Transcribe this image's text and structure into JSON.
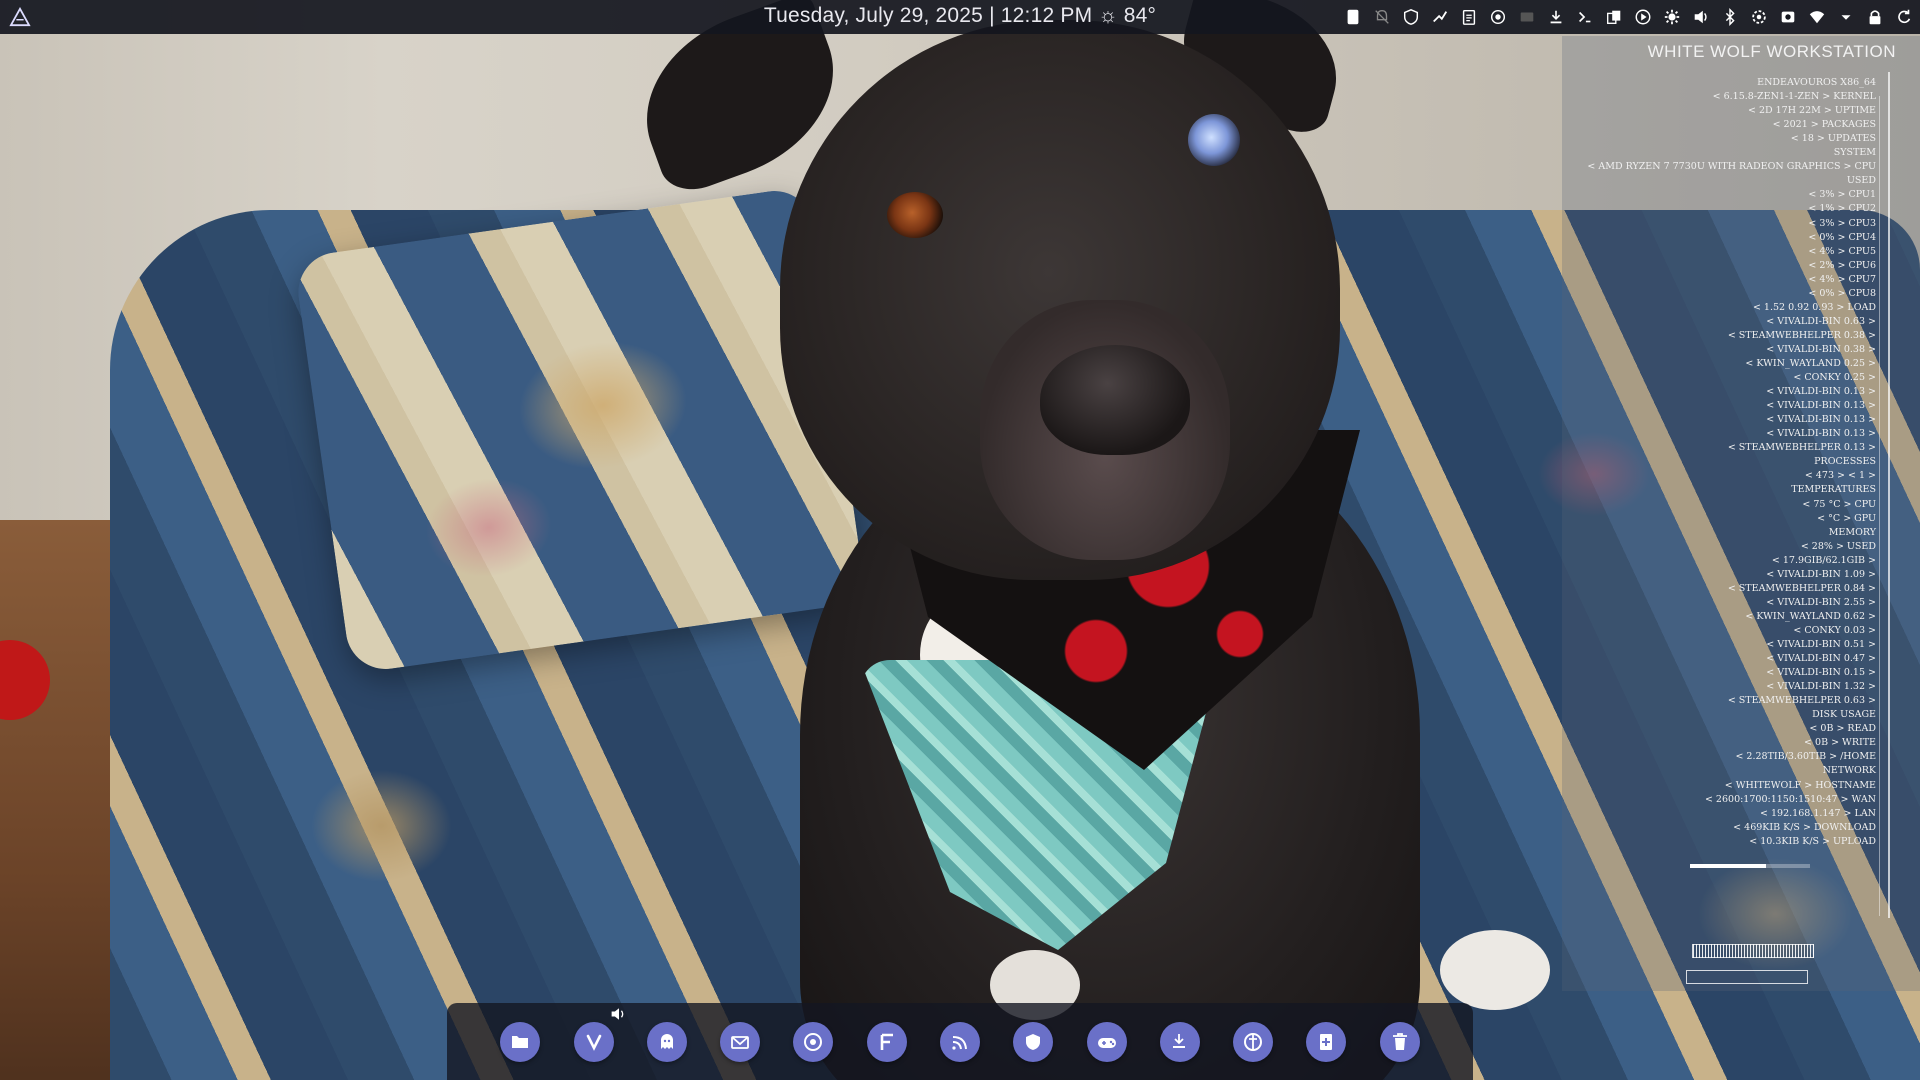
{
  "topbar": {
    "clock_text": "Tuesday, July 29, 2025 | 12:12 PM ☼ 84°",
    "logo_icon": "endeavouros-logo-icon",
    "tray_icons": [
      "notepad-icon",
      "notifications-off-icon",
      "shield-icon",
      "signal-icon",
      "clipboard-icon",
      "vpn-icon",
      "window-icon",
      "download-icon",
      "terminal-icon",
      "copy-icon",
      "media-play-icon",
      "gear-icon",
      "volume-icon",
      "bluetooth-icon",
      "settings-icon",
      "screenshot-icon",
      "wifi-icon",
      "chevron-down-icon",
      "lock-icon",
      "refresh-icon"
    ]
  },
  "conky": {
    "title": "WHITE WOLF WORKSTATION",
    "lines": [
      "ENDEAVOUROS X86_64",
      "< 6.15.8-ZEN1-1-ZEN > KERNEL",
      "< 2D 17H 22M > UPTIME",
      "< 2021 > PACKAGES",
      "< 18 > UPDATES",
      "SYSTEM",
      "< AMD RYZEN 7 7730U WITH RADEON GRAPHICS > CPU",
      "USED",
      "< 3% > CPU1",
      "< 1% > CPU2",
      "< 3% > CPU3",
      "< 0% > CPU4",
      "< 4% > CPU5",
      "< 2% > CPU6",
      "< 4% > CPU7",
      "< 0% > CPU8",
      "< 1.52 0.92 0.93 > LOAD",
      "< VIVALDI-BIN 0.63 >",
      "< STEAMWEBHELPER 0.38 >",
      "< VIVALDI-BIN 0.38 >",
      "< KWIN_WAYLAND 0.25 >",
      "< CONKY 0.25 >",
      "< VIVALDI-BIN 0.13 >",
      "< VIVALDI-BIN 0.13 >",
      "< VIVALDI-BIN 0.13 >",
      "< VIVALDI-BIN 0.13 >",
      "< STEAMWEBHELPER 0.13 >",
      "PROCESSES",
      "< 473 > < 1 >",
      "TEMPERATURES",
      "< 75 °C > CPU",
      "< °C > GPU",
      "MEMORY",
      "< 28% > USED",
      "< 17.9GIB/62.1GIB >",
      "< VIVALDI-BIN 1.09 >",
      "< STEAMWEBHELPER 0.84 >",
      "< VIVALDI-BIN 2.55 >",
      "< KWIN_WAYLAND 0.62 >",
      "< CONKY 0.03 >",
      "< VIVALDI-BIN 0.51 >",
      "< VIVALDI-BIN 0.47 >",
      "< VIVALDI-BIN 0.15 >",
      "< VIVALDI-BIN 1.32 >",
      "< STEAMWEBHELPER 0.63 >",
      "DISK USAGE",
      "< 0B > READ",
      "< 0B > WRITE",
      "< 2.28TIB/3.60TIB > /HOME",
      "NETWORK",
      "< WHITEWOLF > HOSTNAME",
      "< 2600:1700:1150:1510:47 > WAN",
      "< 192.168.1.147 > LAN",
      "< 469KIB K/S > DOWNLOAD",
      "< 10.3KIB K/S > UPLOAD"
    ],
    "disk_home_fraction": 0.63
  },
  "dock": {
    "items": [
      "files-icon",
      "vivaldi-icon",
      "ghost-icon",
      "mail-icon",
      "obs-icon",
      "font-icon",
      "feed-icon",
      "shield-crest-icon",
      "gamepad-icon",
      "download-icon",
      "theme-icon",
      "plus-doc-icon",
      "trash-icon"
    ],
    "accent": "#6a70c8"
  },
  "colors": {
    "topbar_bg": "#14161e",
    "conky_text": "#f0f0f0"
  }
}
